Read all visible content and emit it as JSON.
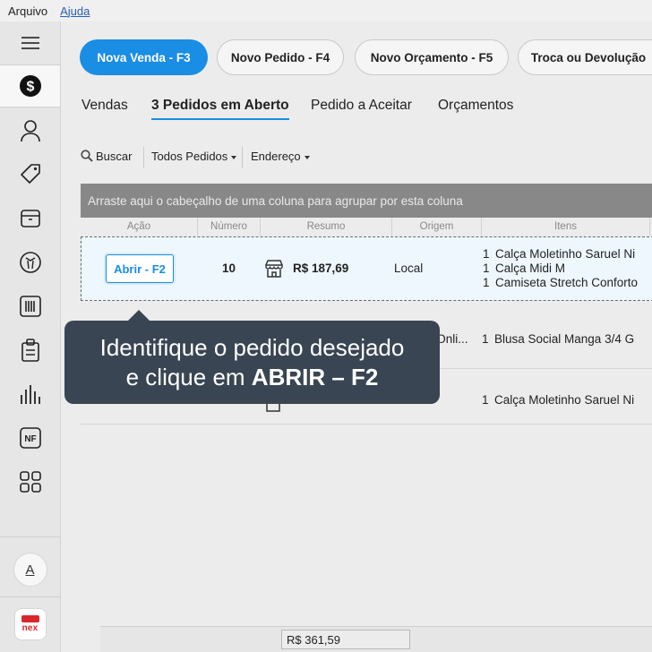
{
  "menubar": {
    "file": "Arquivo",
    "help": "Ajuda"
  },
  "sidebar": {
    "items": [
      {
        "icon": "menu-icon"
      },
      {
        "icon": "dollar-icon",
        "active": true
      },
      {
        "icon": "user-icon"
      },
      {
        "icon": "tag-icon"
      },
      {
        "icon": "box-icon"
      },
      {
        "icon": "shirt-icon"
      },
      {
        "icon": "barcode-icon"
      },
      {
        "icon": "clipboard-icon"
      },
      {
        "icon": "chart-icon"
      },
      {
        "icon": "nf-icon",
        "label": "NF"
      },
      {
        "icon": "apps-icon"
      }
    ],
    "avatar_letter": "A",
    "logo_text": "nex"
  },
  "actions": {
    "new_sale": "Nova Venda - F3",
    "new_order": "Novo Pedido - F4",
    "new_quote": "Novo Orçamento - F5",
    "exchange": "Troca ou Devolução"
  },
  "tabs": [
    "Vendas",
    "3 Pedidos em Aberto",
    "Pedido a Aceitar",
    "Orçamentos"
  ],
  "toolbar": {
    "search": "Buscar",
    "filter_orders": "Todos Pedidos",
    "filter_address": "Endereço"
  },
  "grid": {
    "group_hint": "Arraste aqui o cabeçalho de uma coluna para agrupar por esta coluna",
    "columns": [
      "Ação",
      "Número",
      "Resumo",
      "Origem",
      "Itens"
    ],
    "rows": [
      {
        "action": "Abrir - F2",
        "number": "10",
        "total": "R$ 187,69",
        "origin": "Local",
        "items": [
          {
            "qty": "1",
            "name": "Calça Moletinho Saruel Ni"
          },
          {
            "qty": "1",
            "name": "Calça Midi M"
          },
          {
            "qty": "1",
            "name": "Camiseta Stretch Conforto"
          }
        ]
      },
      {
        "origin": "o Onli...",
        "items": [
          {
            "qty": "1",
            "name": "Blusa Social Manga 3/4 G"
          }
        ]
      },
      {
        "items": [
          {
            "qty": "1",
            "name": "Calça Moletinho Saruel Ni"
          }
        ]
      }
    ],
    "footer_total": "R$ 361,59"
  },
  "tooltip": {
    "line1": "Identifique o pedido desejado",
    "line2_prefix": "e clique em ",
    "line2_bold": "ABRIR – F2"
  },
  "colors": {
    "accent": "#1a8de4",
    "tooltip_bg": "#3a4553",
    "brand_red": "#d9262c"
  }
}
